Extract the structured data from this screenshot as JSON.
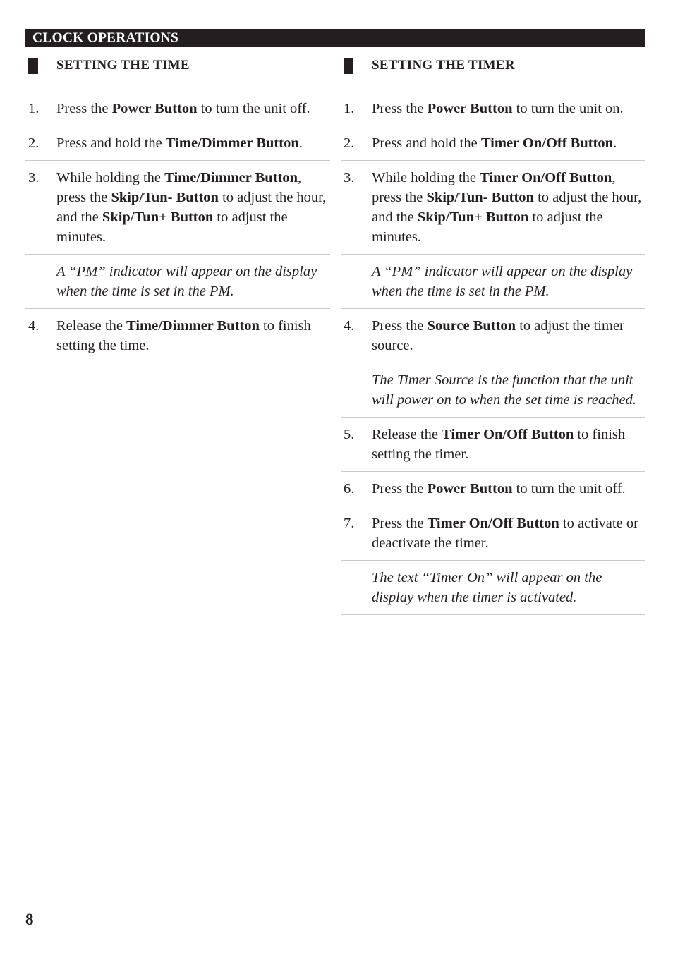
{
  "banner": {
    "title": "CLOCK OPERATIONS"
  },
  "page_number": "8",
  "columns": [
    {
      "heading": "SETTING THE TIME",
      "items": [
        {
          "type": "step",
          "number": "1.",
          "parts": [
            {
              "text": "Press the ",
              "bold": false
            },
            {
              "text": "Power Button",
              "bold": true
            },
            {
              "text": " to turn the unit off.",
              "bold": false
            }
          ]
        },
        {
          "type": "step",
          "number": "2.",
          "parts": [
            {
              "text": "Press and hold the ",
              "bold": false
            },
            {
              "text": "Time/Dimmer Button",
              "bold": true
            },
            {
              "text": ".",
              "bold": false
            }
          ]
        },
        {
          "type": "step",
          "number": "3.",
          "parts": [
            {
              "text": "While holding the ",
              "bold": false
            },
            {
              "text": "Time/Dimmer Button",
              "bold": true
            },
            {
              "text": ", press the ",
              "bold": false
            },
            {
              "text": "Skip/Tun- Button",
              "bold": true
            },
            {
              "text": " to adjust the hour, and the ",
              "bold": false
            },
            {
              "text": "Skip/Tun+ Button",
              "bold": true
            },
            {
              "text": " to adjust the minutes.",
              "bold": false
            }
          ]
        },
        {
          "type": "note",
          "number": "",
          "parts": [
            {
              "text": "A “PM” indicator will appear on the display when the time is set in the PM.",
              "bold": false
            }
          ]
        },
        {
          "type": "step",
          "number": "4.",
          "parts": [
            {
              "text": "Release the ",
              "bold": false
            },
            {
              "text": "Time/Dimmer Button",
              "bold": true
            },
            {
              "text": " to finish setting the time.",
              "bold": false
            }
          ]
        }
      ]
    },
    {
      "heading": "SETTING THE TIMER",
      "items": [
        {
          "type": "step",
          "number": "1.",
          "parts": [
            {
              "text": "Press the ",
              "bold": false
            },
            {
              "text": "Power Button",
              "bold": true
            },
            {
              "text": " to turn the unit on.",
              "bold": false
            }
          ]
        },
        {
          "type": "step",
          "number": "2.",
          "parts": [
            {
              "text": "Press and hold the ",
              "bold": false
            },
            {
              "text": "Timer On/Off Button",
              "bold": true
            },
            {
              "text": ".",
              "bold": false
            }
          ]
        },
        {
          "type": "step",
          "number": "3.",
          "parts": [
            {
              "text": "While holding the ",
              "bold": false
            },
            {
              "text": "Timer On/Off Button",
              "bold": true
            },
            {
              "text": ", press the ",
              "bold": false
            },
            {
              "text": "Skip/Tun- Button",
              "bold": true
            },
            {
              "text": " to adjust the hour, and the ",
              "bold": false
            },
            {
              "text": "Skip/Tun+ Button",
              "bold": true
            },
            {
              "text": " to adjust the minutes.",
              "bold": false
            }
          ]
        },
        {
          "type": "note",
          "number": "",
          "parts": [
            {
              "text": "A “PM” indicator will appear on the display when the time is set in the PM.",
              "bold": false
            }
          ]
        },
        {
          "type": "step",
          "number": "4.",
          "parts": [
            {
              "text": "Press the ",
              "bold": false
            },
            {
              "text": "Source Button",
              "bold": true
            },
            {
              "text": " to adjust the timer source.",
              "bold": false
            }
          ]
        },
        {
          "type": "note",
          "number": "",
          "parts": [
            {
              "text": "The Timer Source is the function that the unit will power on to when the set time is reached.",
              "bold": false
            }
          ]
        },
        {
          "type": "step",
          "number": "5.",
          "parts": [
            {
              "text": "Release the ",
              "bold": false
            },
            {
              "text": "Timer On/Off Button",
              "bold": true
            },
            {
              "text": " to finish setting the timer.",
              "bold": false
            }
          ]
        },
        {
          "type": "step",
          "number": "6.",
          "parts": [
            {
              "text": "Press the ",
              "bold": false
            },
            {
              "text": "Power Button",
              "bold": true
            },
            {
              "text": " to turn the unit off.",
              "bold": false
            }
          ]
        },
        {
          "type": "step",
          "number": "7.",
          "parts": [
            {
              "text": "Press the ",
              "bold": false
            },
            {
              "text": "Timer On/Off Button",
              "bold": true
            },
            {
              "text": " to activate or deactivate the timer.",
              "bold": false
            }
          ]
        },
        {
          "type": "note",
          "number": "",
          "parts": [
            {
              "text": "The text “Timer On” will appear on the display when the timer is activated.",
              "bold": false
            }
          ]
        }
      ]
    }
  ],
  "colors": {
    "ink": "#231f20",
    "rule": "#c9c9c9",
    "paper": "#ffffff"
  }
}
